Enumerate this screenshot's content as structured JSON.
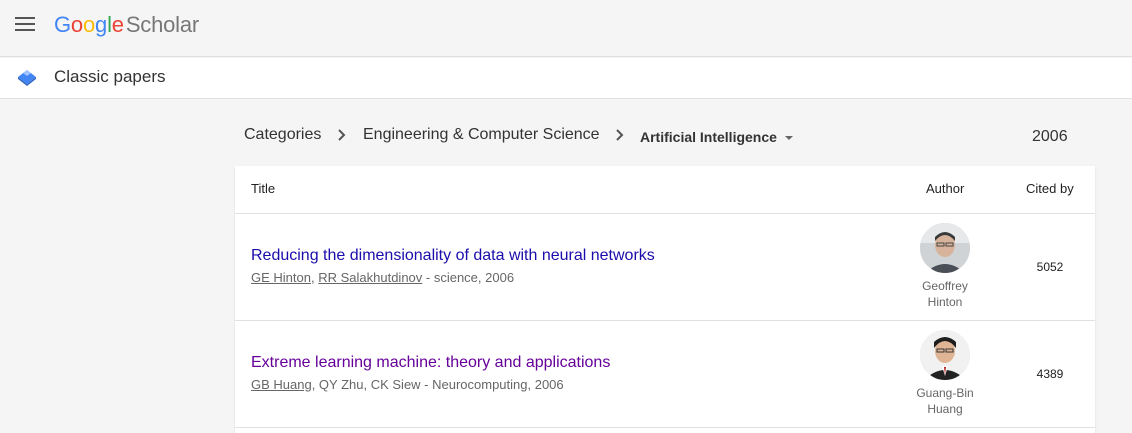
{
  "header": {
    "logo_google": [
      "G",
      "o",
      "o",
      "g",
      "l",
      "e"
    ],
    "logo_product": "Scholar"
  },
  "subheader": {
    "title": "Classic papers"
  },
  "breadcrumb": {
    "items": [
      "Categories",
      "Engineering & Computer Science"
    ],
    "current": "Artificial Intelligence"
  },
  "year": "2006",
  "table": {
    "columns": {
      "title": "Title",
      "author": "Author",
      "cited": "Cited by"
    },
    "rows": [
      {
        "title": "Reducing the dimensionality of data with neural networks",
        "authors_linked": [
          "GE Hinton",
          "RR Salakhutdinov"
        ],
        "authors_plain": "",
        "venue": " - science, 2006",
        "author_name_line1": "Geoffrey",
        "author_name_line2": "Hinton",
        "cited_by": "5052"
      },
      {
        "title": "Extreme learning machine: theory and applications",
        "authors_linked": [
          "GB Huang"
        ],
        "authors_plain": ", QY Zhu, CK Siew",
        "venue": " - Neurocomputing, 2006",
        "author_name_line1": "Guang-Bin",
        "author_name_line2": "Huang",
        "cited_by": "4389"
      }
    ]
  },
  "colors": {
    "link": "#1a0dab",
    "visited_link": "#660099",
    "brand_blue": "#4285f4"
  }
}
